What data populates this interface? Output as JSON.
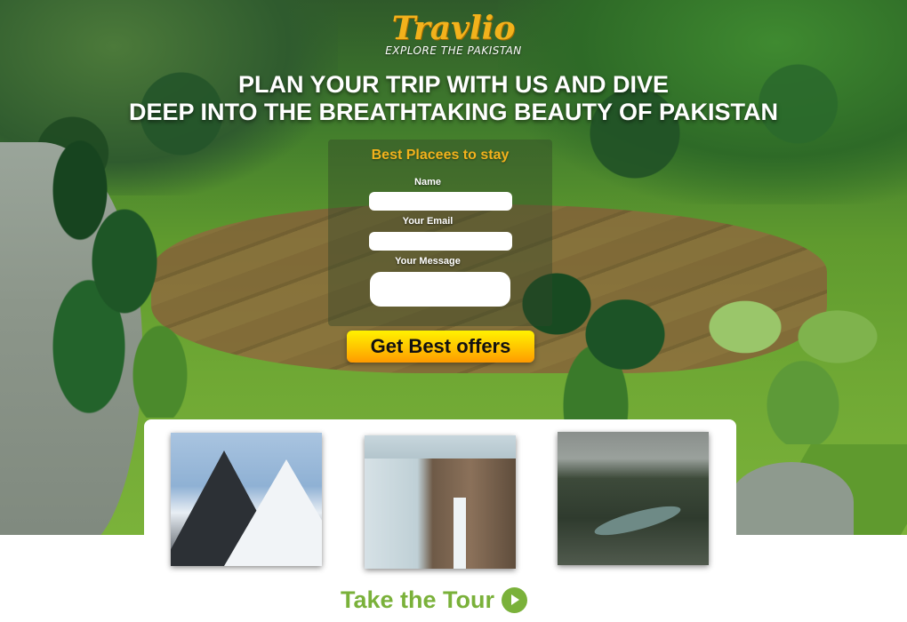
{
  "brand": {
    "logo_text": "Travlio",
    "tagline": "EXPLORE THE PAKISTAN",
    "accent_color": "#f2b21c",
    "tour_color": "#7ab13a"
  },
  "hero": {
    "headline_line1": "PLAN YOUR TRIP WITH US AND DIVE",
    "headline_line2": "DEEP INTO THE BREATHTAKING BEAUTY OF PAKISTAN"
  },
  "form": {
    "title": "Best Placees to stay",
    "name_label": "Name",
    "email_label": "Your Email",
    "message_label": "Your Message",
    "name_value": "",
    "email_value": "",
    "message_value": "",
    "submit_label": "Get Best offers"
  },
  "gallery": {
    "photos": [
      "snowy-mountains",
      "waterfall-cliff",
      "river-canyon"
    ]
  },
  "footer": {
    "tour_label": "Take the Tour",
    "tour_icon": "arrow-right-circle-icon"
  }
}
